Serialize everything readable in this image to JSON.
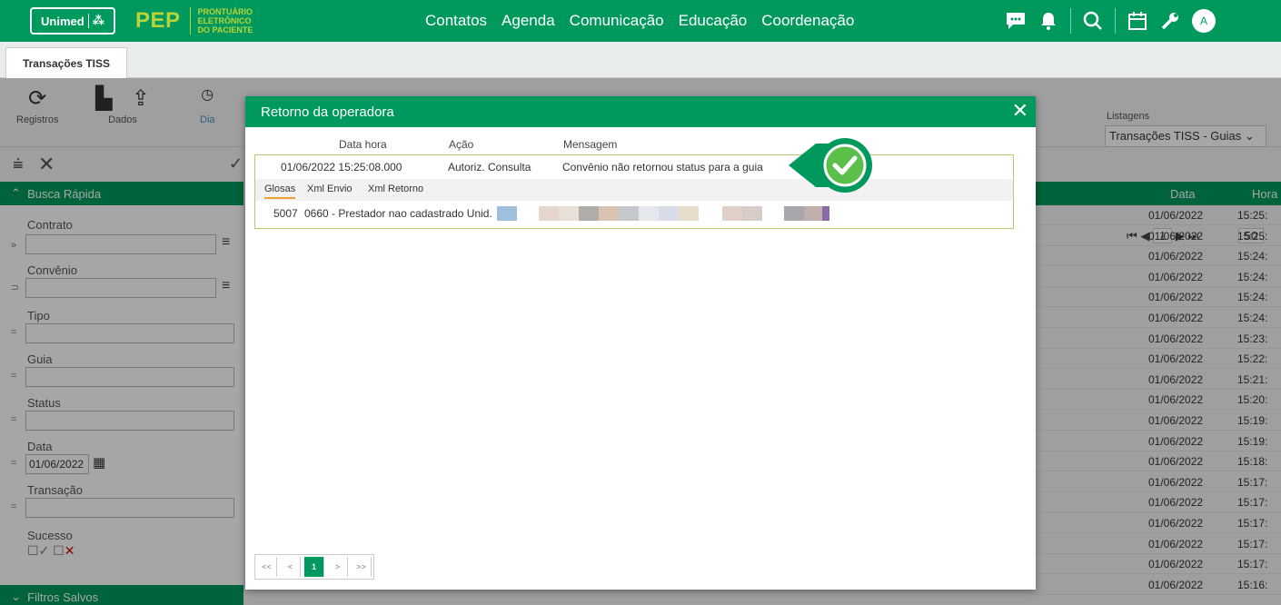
{
  "header": {
    "logo": "Unimed",
    "app_name": "PEP",
    "app_subtitle_1": "PRONTUÁRIO ELETRÔNICO",
    "app_subtitle_2": "DO PACIENTE",
    "menu": [
      "Contatos",
      "Agenda",
      "Comunicação",
      "Educação",
      "Coordenação"
    ],
    "avatar_initial": "A"
  },
  "tabs": {
    "active": "Transações TISS"
  },
  "toolbar": {
    "registros": "Registros",
    "dados": "Dados",
    "dia": "Dia",
    "listagens_label": "Listagens",
    "listagens_value": "Transações TISS - Guias"
  },
  "pager_top": {
    "page": "1",
    "size": "50"
  },
  "sidebar": {
    "busca_rapida": "Busca Rápida",
    "contrato": "Contrato",
    "convenio": "Convênio",
    "tipo": "Tipo",
    "guia": "Guia",
    "status": "Status",
    "data": "Data",
    "data_value": "01/06/2022",
    "transacao": "Transação",
    "sucesso": "Sucesso",
    "filtros_salvos": "Filtros Salvos"
  },
  "grid": {
    "col_data": "Data",
    "col_hora": "Hora",
    "rows": [
      [
        "01/06/2022",
        "15:25:"
      ],
      [
        "01/06/2022",
        "15:25:"
      ],
      [
        "01/06/2022",
        "15:24:"
      ],
      [
        "01/06/2022",
        "15:24:"
      ],
      [
        "01/06/2022",
        "15:24:"
      ],
      [
        "01/06/2022",
        "15:24:"
      ],
      [
        "01/06/2022",
        "15:23:"
      ],
      [
        "01/06/2022",
        "15:22:"
      ],
      [
        "01/06/2022",
        "15:21:"
      ],
      [
        "01/06/2022",
        "15:20:"
      ],
      [
        "01/06/2022",
        "15:19:"
      ],
      [
        "01/06/2022",
        "15:19:"
      ],
      [
        "01/06/2022",
        "15:18:"
      ],
      [
        "01/06/2022",
        "15:17:"
      ],
      [
        "01/06/2022",
        "15:17:"
      ],
      [
        "01/06/2022",
        "15:17:"
      ],
      [
        "01/06/2022",
        "15:17:"
      ],
      [
        "01/06/2022",
        "15:17:"
      ],
      [
        "01/06/2022",
        "15:16:"
      ]
    ]
  },
  "modal": {
    "title": "Retorno da operadora",
    "col_datahora": "Data hora",
    "col_acao": "Ação",
    "col_mensagem": "Mensagem",
    "record": {
      "datahora": "01/06/2022 15:25:08.000",
      "acao": "Autoriz. Consulta",
      "mensagem": "Convênio não retornou status para a guia"
    },
    "subtabs": [
      "Glosas",
      "Xml Envio",
      "Xml Retorno"
    ],
    "glosa": {
      "code": "5007",
      "desc": "0660 - Prestador nao cadastrado Unid."
    },
    "pager": {
      "first": "<<",
      "prev": "<",
      "current": "1",
      "next": ">",
      "last": ">>"
    }
  },
  "colors": {
    "brand": "#00995d",
    "accent": "#b8d438"
  }
}
